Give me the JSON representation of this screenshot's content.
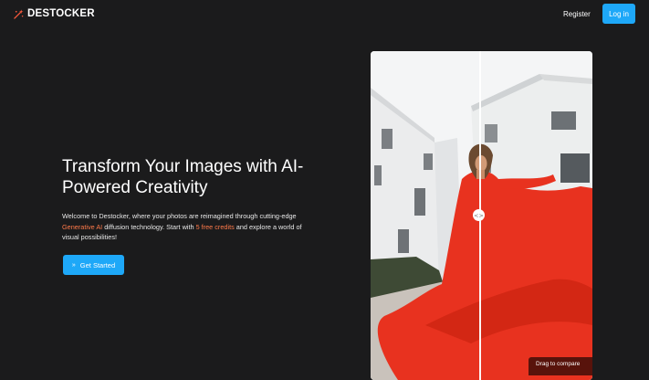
{
  "header": {
    "logo_text": "DESTOCKER",
    "logo_icon": "sparkle-wand-icon",
    "register_label": "Register",
    "login_label": "Log in"
  },
  "hero": {
    "title": "Transform Your Images with AI-Powered Creativity",
    "desc_part1": "Welcome to Destocker, where your photos are reimagined through cutting-edge ",
    "desc_highlight1": "Generative AI",
    "desc_part2": " diffusion technology. Start with ",
    "desc_highlight2": "5 free credits",
    "desc_part3": " and explore a world of visual possibilities!",
    "cta_label": "Get Started",
    "cta_icon": "chevrons-right-icon"
  },
  "compare": {
    "handle_icon": "code-arrows-icon",
    "handle_glyph": "<>",
    "hint_text": "Drag to compare"
  },
  "colors": {
    "background": "#1b1b1c",
    "accent_orange": "#ff7a4a",
    "primary_blue": "#1ea8f8",
    "logo_red": "#ff5a3c"
  }
}
